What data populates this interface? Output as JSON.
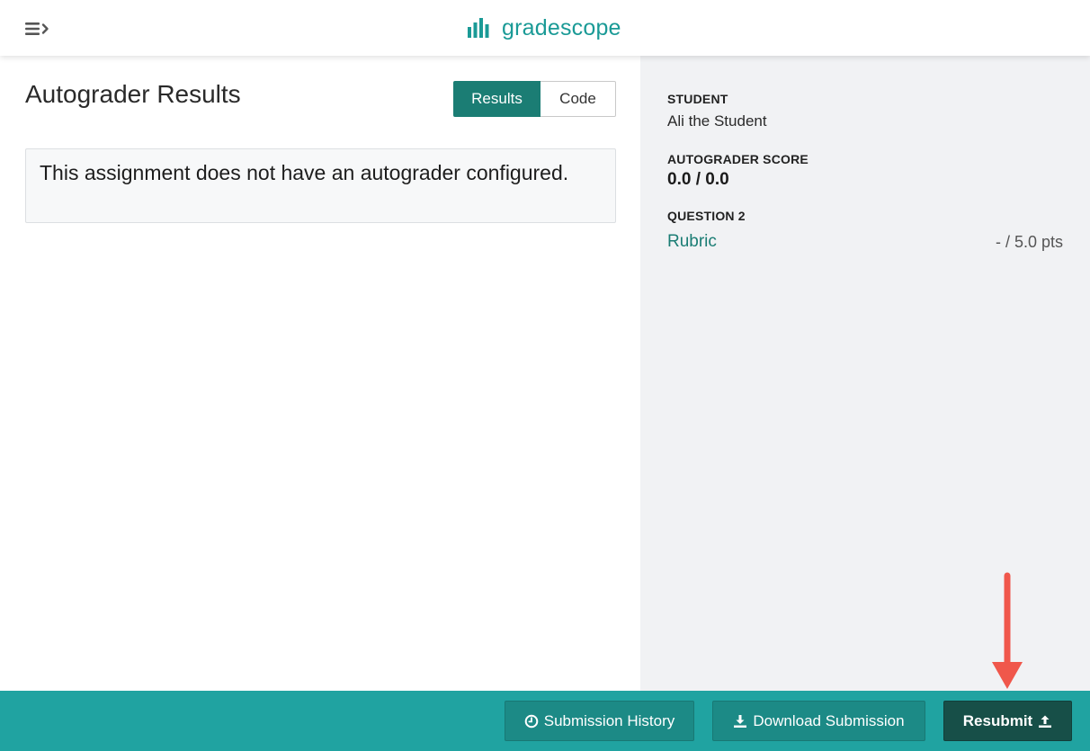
{
  "header": {
    "brand_name": "gradescope",
    "brand_color": "#1a9a96"
  },
  "main": {
    "title": "Autograder Results",
    "tabs": [
      {
        "label": "Results",
        "active": true
      },
      {
        "label": "Code",
        "active": false
      }
    ],
    "notice": "This assignment does not have an autograder configured."
  },
  "sidebar": {
    "student_label": "STUDENT",
    "student_name": "Ali the Student",
    "score_label": "AUTOGRADER SCORE",
    "score_value": "0.0 / 0.0",
    "question_label": "QUESTION 2",
    "rubric_link": "Rubric",
    "points": "- / 5.0 pts"
  },
  "footer": {
    "history_label": "Submission History",
    "download_label": "Download Submission",
    "resubmit_label": "Resubmit",
    "bar_color": "#20a3a1"
  },
  "icons": {
    "menu": "hamburger-chevron-icon",
    "brand": "bar-chart-logo-icon",
    "history": "clock-icon",
    "download": "download-icon",
    "resubmit": "upload-icon",
    "annotation": "red-arrow-down-icon"
  }
}
